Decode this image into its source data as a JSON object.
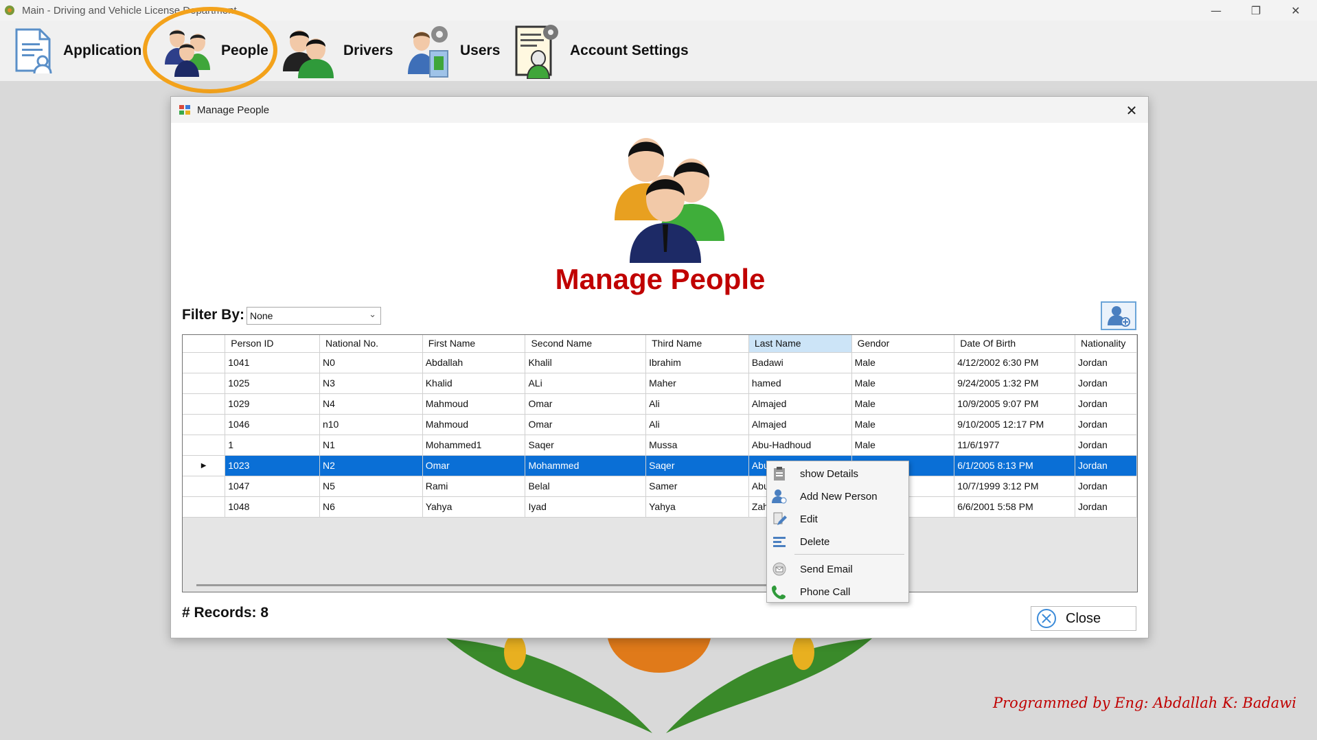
{
  "window": {
    "title": "Main - Driving and Vehicle License Department",
    "minimize_glyph": "—",
    "restore_glyph": "❐",
    "close_glyph": "✕"
  },
  "menu": {
    "items": [
      {
        "label": "Application",
        "icon": "application-form-icon"
      },
      {
        "label": "People",
        "icon": "people-icon",
        "highlighted": true
      },
      {
        "label": "Drivers",
        "icon": "drivers-icon"
      },
      {
        "label": "Users",
        "icon": "users-icon"
      },
      {
        "label": "Account Settings",
        "icon": "account-settings-icon"
      }
    ],
    "highlight_color": "#f3a21b"
  },
  "credit": "Programmed by Eng: Abdallah K: Badawi",
  "dialog": {
    "title": "Manage People",
    "close_glyph": "✕",
    "heading": "Manage People",
    "heading_color": "#c00000",
    "filter": {
      "label": "Filter By:",
      "selected": "None"
    },
    "records_label": "# Records: 8",
    "close_button_label": "Close"
  },
  "grid": {
    "columns": [
      "Person ID",
      "National No.",
      "First Name",
      "Second Name",
      "Third Name",
      "Last Name",
      "Gendor",
      "Date Of Birth",
      "Nationality"
    ],
    "sorted_column": "Last Name",
    "selected_row_index": 5,
    "selection_color": "#0a6fd6",
    "rows": [
      [
        "1041",
        "N0",
        "Abdallah",
        "Khalil",
        "Ibrahim",
        "Badawi",
        "Male",
        "4/12/2002 6:30 PM",
        "Jordan"
      ],
      [
        "1025",
        "N3",
        "Khalid",
        "ALi",
        "Maher",
        "hamed",
        "Male",
        "9/24/2005 1:32 PM",
        "Jordan"
      ],
      [
        "1029",
        "N4",
        "Mahmoud",
        "Omar",
        "Ali",
        "Almajed",
        "Male",
        "10/9/2005 9:07 PM",
        "Jordan"
      ],
      [
        "1046",
        "n10",
        "Mahmoud",
        "Omar",
        "Ali",
        "Almajed",
        "Male",
        "9/10/2005 12:17 PM",
        "Jordan"
      ],
      [
        "1",
        "N1",
        "Mohammed1",
        "Saqer",
        "Mussa",
        "Abu-Hadhoud",
        "Male",
        "11/6/1977",
        "Jordan"
      ],
      [
        "1023",
        "N2",
        "Omar",
        "Mohammed",
        "Saqer",
        "Abu",
        "",
        "6/1/2005 8:13 PM",
        "Jordan"
      ],
      [
        "1047",
        "N5",
        "Rami",
        "Belal",
        "Samer",
        "Abu",
        "",
        "10/7/1999 3:12 PM",
        "Jordan"
      ],
      [
        "1048",
        "N6",
        "Yahya",
        "Iyad",
        "Yahya",
        "Zah",
        "",
        "6/6/2001 5:58 PM",
        "Jordan"
      ]
    ]
  },
  "context_menu": {
    "items": [
      {
        "label": "show Details",
        "icon": "clipboard-details-icon"
      },
      {
        "label": "Add New Person",
        "icon": "add-person-icon"
      },
      {
        "label": "Edit",
        "icon": "edit-pencil-icon"
      },
      {
        "label": "Delete",
        "icon": "delete-icon"
      },
      {
        "label": "Send Email",
        "icon": "email-icon"
      },
      {
        "label": "Phone Call",
        "icon": "phone-icon"
      }
    ]
  }
}
